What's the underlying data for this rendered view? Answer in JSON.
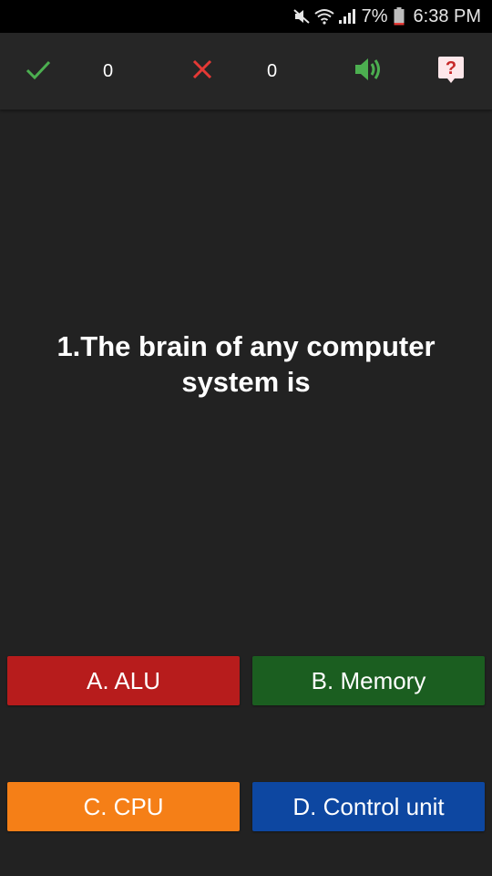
{
  "status_bar": {
    "battery_percent": "7%",
    "time": "6:38 PM",
    "icons": [
      "mute-icon",
      "wifi-icon",
      "signal-icon",
      "battery-icon"
    ]
  },
  "toolbar": {
    "correct_count": "0",
    "wrong_count": "0",
    "icons": {
      "correct": "check-icon",
      "wrong": "cross-icon",
      "sound": "speaker-icon",
      "help": "help-icon"
    },
    "colors": {
      "correct": "#4caf50",
      "wrong": "#e53935",
      "sound": "#4caf50",
      "help_bg": "#fde7ea",
      "help_fg": "#c62828"
    }
  },
  "question": {
    "text": "1.The brain of any computer system is"
  },
  "answers": [
    {
      "label": "A. ALU",
      "color": "#b71c1c"
    },
    {
      "label": "B. Memory",
      "color": "#1b5e20"
    },
    {
      "label": "C. CPU",
      "color": "#f57f17"
    },
    {
      "label": "D. Control unit",
      "color": "#0d47a1"
    }
  ]
}
